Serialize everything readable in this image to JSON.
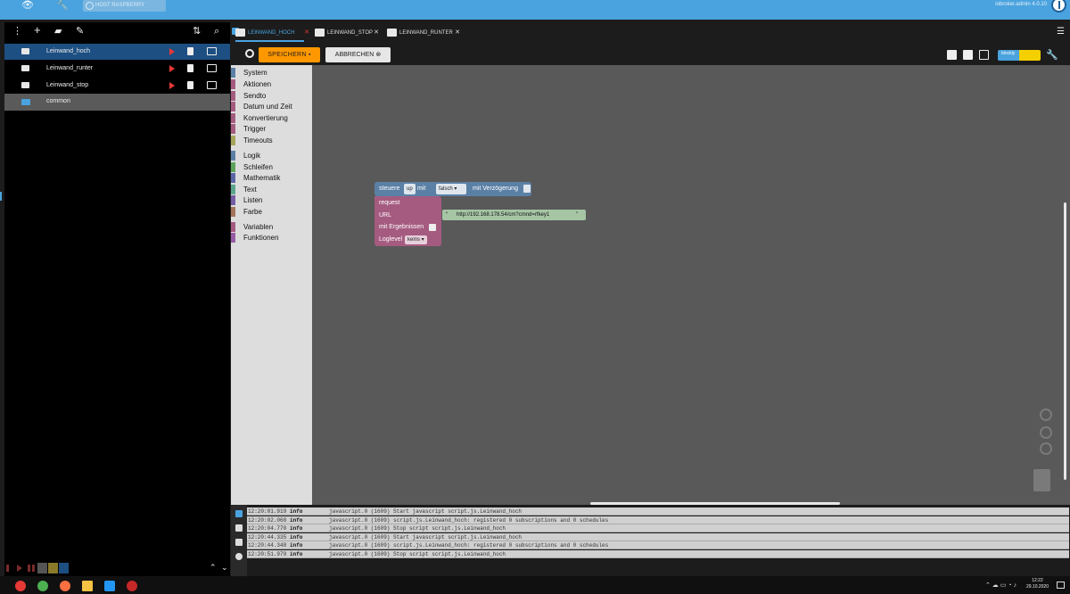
{
  "topbar": {
    "eye_icon": "eye-icon",
    "wrench_icon": "wrench-icon",
    "host_label": "HOST RASPBERRY",
    "user_info": "iobroker.admin 4.0.10"
  },
  "tree": {
    "items": [
      {
        "name": "Leinwand_hoch",
        "selected": true
      },
      {
        "name": "Leinwand_runter",
        "selected": false
      },
      {
        "name": "Leinwand_stop",
        "selected": false
      }
    ],
    "folder": {
      "name": "common"
    }
  },
  "tabs": [
    {
      "label": "LEINWAND_HOCH",
      "active": true
    },
    {
      "label": "LEINWAND_STOP",
      "active": false
    },
    {
      "label": "LEINWAND_RUNTER",
      "active": false
    }
  ],
  "toolbar": {
    "save_label": "SPEICHERN",
    "cancel_label": "ABBRECHEN",
    "mode_label": "blockly"
  },
  "toolbox": {
    "categories": [
      {
        "label": "System",
        "color": "#5b80a5"
      },
      {
        "label": "Aktionen",
        "color": "#a55b80"
      },
      {
        "label": "Sendto",
        "color": "#a55b80"
      },
      {
        "label": "Datum und Zeit",
        "color": "#a55b80"
      },
      {
        "label": "Konvertierung",
        "color": "#a55b80"
      },
      {
        "label": "Trigger",
        "color": "#a55b80"
      },
      {
        "label": "Timeouts",
        "color": "#a5a55b"
      },
      {
        "label": "Logik",
        "color": "#5b80a5"
      },
      {
        "label": "Schleifen",
        "color": "#5ba55b"
      },
      {
        "label": "Mathematik",
        "color": "#5b67a5"
      },
      {
        "label": "Text",
        "color": "#5ba58c"
      },
      {
        "label": "Listen",
        "color": "#745ba5"
      },
      {
        "label": "Farbe",
        "color": "#a5745b"
      },
      {
        "label": "Variablen",
        "color": "#a55b80"
      },
      {
        "label": "Funktionen",
        "color": "#995ba5"
      }
    ]
  },
  "blocks": {
    "control": {
      "label_control": "steuere",
      "object": "up",
      "label_with": "mit",
      "value": "falsch",
      "label_delay": "mit Verzögerung"
    },
    "request": {
      "title": "request",
      "url_label": "URL",
      "url_value": "http://192.168.178.54/cm?cmnd=rfkey1",
      "results_label": "mit Ergebnissen",
      "loglevel_label": "Loglevel",
      "loglevel_value": "keins"
    }
  },
  "log": [
    {
      "time": "12:20:01.919",
      "severity": "info",
      "message": "javascript.0 (1609) Start javascript script.js.Leinwand_hoch"
    },
    {
      "time": "12:20:02.068",
      "severity": "info",
      "message": "javascript.0 (1609) script.js.Leinwand_hoch: registered 0 subscriptions and 0 schedules"
    },
    {
      "time": "12:20:04.770",
      "severity": "info",
      "message": "javascript.0 (1609) Stop script script.js.Leinwand_hoch"
    },
    {
      "time": "12:20:44.335",
      "severity": "info",
      "message": "javascript.0 (1609) Start javascript script.js.Leinwand_hoch"
    },
    {
      "time": "12:20:44.348",
      "severity": "info",
      "message": "javascript.0 (1609) script.js.Leinwand_hoch: registered 0 subscriptions and 0 schedules"
    },
    {
      "time": "12:20:51.979",
      "severity": "info",
      "message": "javascript.0 (1609) Stop script script.js.Leinwand_hoch"
    }
  ],
  "taskbar": {
    "time": "12:22",
    "date": "29.10.2020"
  }
}
